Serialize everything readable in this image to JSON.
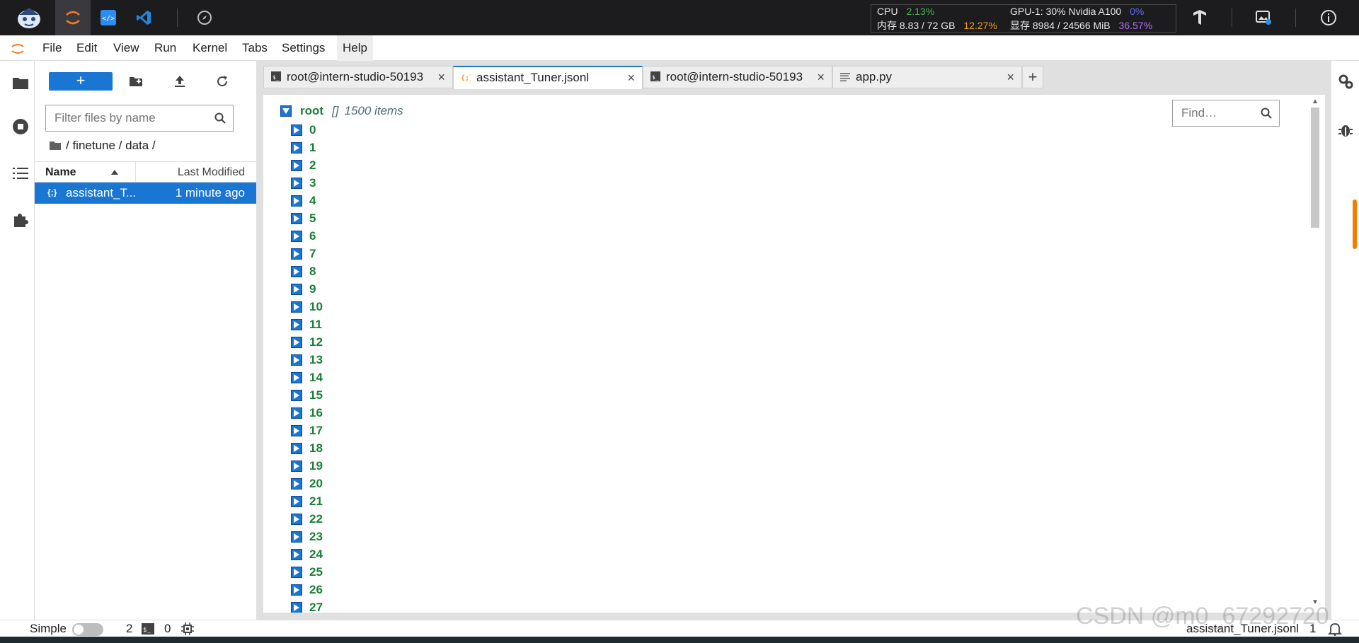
{
  "topbar": {
    "monitor": {
      "cpu_label": "CPU",
      "cpu_value": "2.13%",
      "mem_label": "内存 8.83 / 72 GB",
      "mem_percent": "12.27%",
      "gpu_label": "GPU-1: 30% Nvidia A100",
      "gpu_percent": "0%",
      "vram_label": "显存 8984 / 24566 MiB",
      "vram_percent": "36.57%"
    }
  },
  "menubar": {
    "items": [
      "File",
      "Edit",
      "View",
      "Run",
      "Kernel",
      "Tabs",
      "Settings",
      "Help"
    ]
  },
  "filebrowser": {
    "new_label": "+",
    "filter_placeholder": "Filter files by name",
    "breadcrumb": "/ finetune / data /",
    "header_name": "Name",
    "header_modified": "Last Modified",
    "files": [
      {
        "name": "assistant_T...",
        "modified": "1 minute ago",
        "icon": "{;}"
      }
    ]
  },
  "tabs": [
    {
      "label": "root@intern-studio-50193",
      "icon": "terminal-icon"
    },
    {
      "label": "assistant_Tuner.jsonl",
      "icon": "json-icon"
    },
    {
      "label": "root@intern-studio-50193",
      "icon": "terminal-icon"
    },
    {
      "label": "app.py",
      "icon": "text-file-icon"
    }
  ],
  "viewer": {
    "find_placeholder": "Find…",
    "root_label": "root",
    "root_type": "[]",
    "root_count": "1500 items",
    "indices": [
      "0",
      "1",
      "2",
      "3",
      "4",
      "5",
      "6",
      "7",
      "8",
      "9",
      "10",
      "11",
      "12",
      "13",
      "14",
      "15",
      "16",
      "17",
      "18",
      "19",
      "20",
      "21",
      "22",
      "23",
      "24",
      "25",
      "26",
      "27"
    ]
  },
  "statusbar": {
    "mode_label": "Simple",
    "terminals_count": "2",
    "kernels_count": "0",
    "current_file": "assistant_Tuner.jsonl",
    "line_col": "1"
  },
  "watermark": "CSDN @m0_67292720"
}
